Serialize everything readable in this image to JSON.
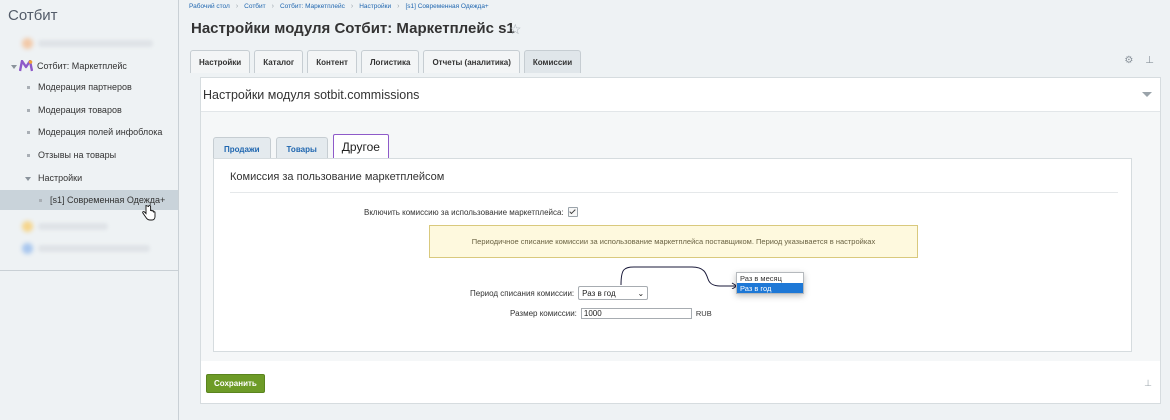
{
  "sidebar": {
    "title": "Сотбит",
    "items": [
      {
        "label": "Сотбит: Маркетплейс"
      },
      {
        "label": "Модерация партнеров"
      },
      {
        "label": "Модерация товаров"
      },
      {
        "label": "Модерация полей инфоблока"
      },
      {
        "label": "Отзывы на товары"
      },
      {
        "label": "Настройки"
      },
      {
        "label": "[s1] Современная Одежда+"
      }
    ]
  },
  "breadcrumb": [
    "Рабочий стол",
    "Сотбит",
    "Сотбит: Маркетплейс",
    "Настройки",
    "[s1] Современная Одежда+"
  ],
  "page_title": "Настройки модуля Сотбит: Маркетплейс s1",
  "tabs": [
    "Настройки",
    "Каталог",
    "Контент",
    "Логистика",
    "Отчеты (аналитика)",
    "Комиссии"
  ],
  "active_tab": "Комиссии",
  "panel": {
    "title": "Настройки модуля sotbit.commissions",
    "subtabs": [
      "Продажи",
      "Товары",
      "Другое"
    ],
    "section_title": "Комиссия за пользование маркетплейсом",
    "enable_label": "Включить комиссию за использование маркетплейса:",
    "enable_checked": true,
    "notice": "Периодичное списание комиссии за использование маркетплейса поставщиком. Период указывается в настройках",
    "period_label": "Период списания комиссии:",
    "period_value": "Раз в год",
    "period_options": [
      "Раз в месяц",
      "Раз в год"
    ],
    "size_label": "Размер комиссии:",
    "size_value": "1000",
    "size_unit": "RUB"
  },
  "save_label": "Сохранить",
  "colors": {
    "accent": "#6d9b27",
    "link": "#2067b0",
    "highlight": "#1e78d6",
    "subtab_border": "#8e5ac9"
  }
}
